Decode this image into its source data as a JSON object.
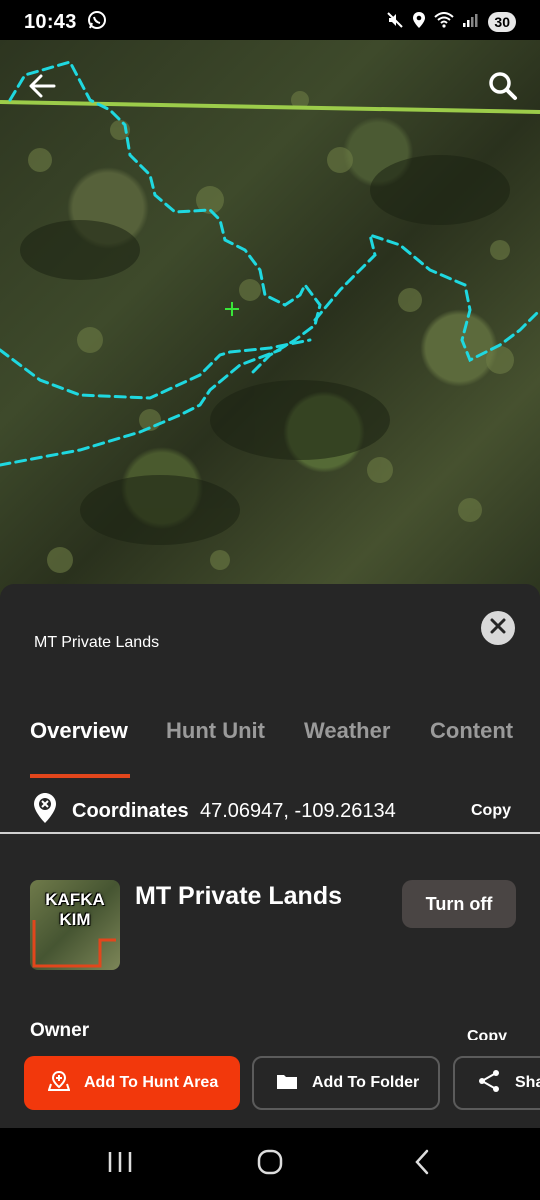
{
  "status_bar": {
    "time": "10:43",
    "battery": "30",
    "icons": [
      "whatsapp-icon",
      "mute-icon",
      "location-icon",
      "wifi-icon",
      "signal-icon"
    ]
  },
  "map": {
    "icons": [
      "back-arrow-icon",
      "search-icon"
    ],
    "colors": {
      "trail": "#1fd8e0",
      "boundary": "#9ccc4a",
      "crosshair": "#39e639"
    }
  },
  "sheet": {
    "title": "MT Private Lands",
    "tabs": [
      "Overview",
      "Hunt Unit",
      "Weather",
      "Content"
    ],
    "active_tab": "Overview",
    "coordinates": {
      "label": "Coordinates",
      "value": "47.06947, -109.26134",
      "copy_label": "Copy"
    },
    "layer": {
      "thumb_text_1": "KAFKA",
      "thumb_text_2": "KIM",
      "name": "MT Private Lands",
      "toggle_label": "Turn off"
    },
    "owner": {
      "label": "Owner",
      "copy_label": "Copy"
    },
    "actions": {
      "add_hunt_area": "Add To Hunt Area",
      "add_folder": "Add To Folder",
      "share": "Share"
    }
  },
  "colors": {
    "accent": "#f2380c",
    "sheet_bg": "#262626",
    "tab_underline": "#e2461c"
  }
}
